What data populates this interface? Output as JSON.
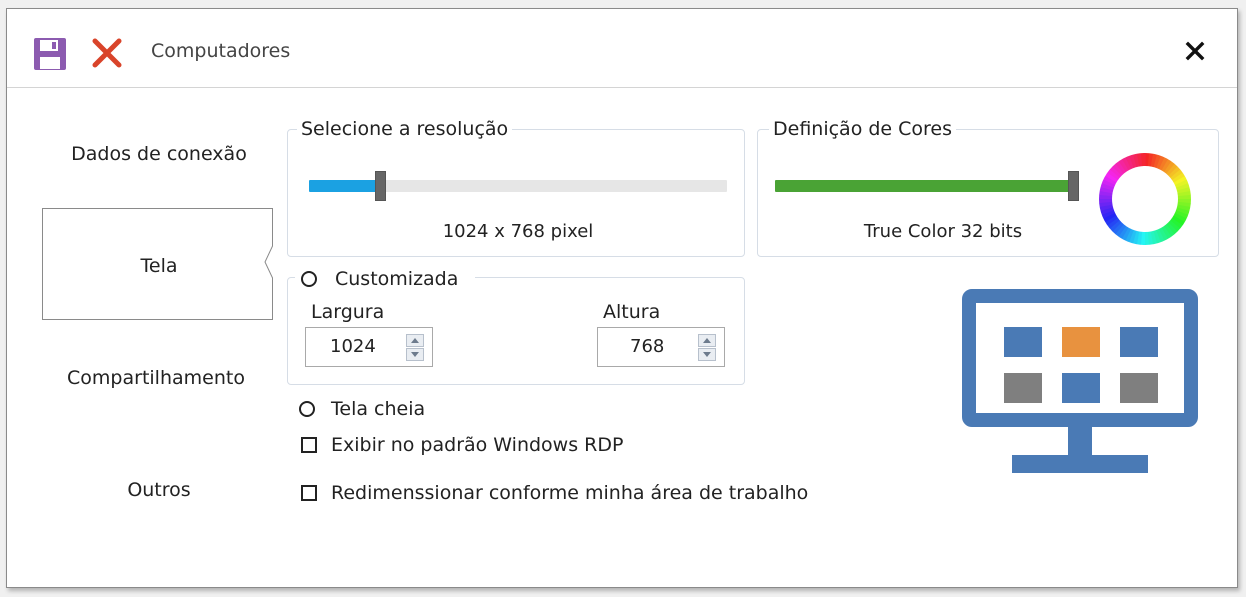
{
  "window": {
    "title": "Computadores",
    "save_icon": "floppy-disk-icon",
    "discard_icon": "red-x-icon",
    "close_icon": "close-icon"
  },
  "nav": {
    "items": [
      {
        "label": "Dados de conexão",
        "selected": false
      },
      {
        "label": "Tela",
        "selected": true
      },
      {
        "label": "Compartilhamento",
        "selected": false
      },
      {
        "label": "Outros",
        "selected": false
      }
    ]
  },
  "resolution": {
    "legend": "Selecione a resolução",
    "value_text": "1024 x 768 pixel",
    "slider_fraction": 0.17,
    "fill_color": "#1ba1e2",
    "track_color": "#e6e6e6"
  },
  "colors": {
    "legend": "Definição de Cores",
    "value_text": "True Color 32 bits",
    "slider_fraction": 1.0,
    "fill_color": "#4aa335",
    "wheel_icon": "color-wheel-icon"
  },
  "custom": {
    "radio_label": "Customizada",
    "selected": false,
    "width_label": "Largura",
    "width_value": "1024",
    "height_label": "Altura",
    "height_value": "768"
  },
  "fullscreen": {
    "radio_label": "Tela cheia",
    "selected": false
  },
  "options": {
    "rdp_label": "Exibir no padrão Windows RDP",
    "rdp_checked": false,
    "resize_label": "Redimenssionar conforme minha área de trabalho",
    "resize_checked": false
  },
  "illustration": {
    "icon": "monitor-icon",
    "frame_color": "#4a7ab5",
    "tile_colors": [
      "#4a7ab5",
      "#e8923f",
      "#4a7ab5",
      "#7f7f7f",
      "#4a7ab5",
      "#7f7f7f"
    ]
  }
}
